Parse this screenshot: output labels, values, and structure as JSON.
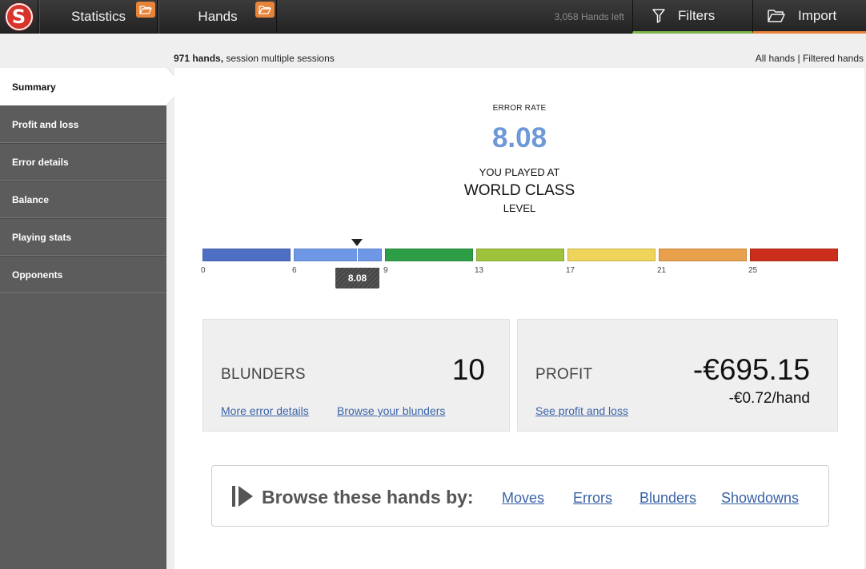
{
  "topbar": {
    "logo_letter": "S",
    "tabs": [
      {
        "label": "Statistics"
      },
      {
        "label": "Hands"
      }
    ],
    "hands_left": "3,058 Hands left",
    "filters_label": "Filters",
    "import_label": "Import",
    "colors": {
      "filters_accent": "#7ab648",
      "import_accent": "#e8833a",
      "logo": "#d8342c"
    }
  },
  "session": {
    "count": "971 hands,",
    "description": "session multiple sessions",
    "filter_text": "All hands | Filtered hands"
  },
  "sidebar": {
    "items": [
      {
        "label": "Summary",
        "active": true
      },
      {
        "label": "Profit and loss"
      },
      {
        "label": "Error details"
      },
      {
        "label": "Balance"
      },
      {
        "label": "Playing stats"
      },
      {
        "label": "Opponents"
      }
    ]
  },
  "summary": {
    "error_rate_label": "ERROR RATE",
    "error_rate": "8.08",
    "played_at": "YOU PLAYED AT",
    "level_name": "WORLD CLASS",
    "level_word": "LEVEL",
    "scale": {
      "ticks": [
        "0",
        "6",
        "9",
        "13",
        "17",
        "21",
        "25"
      ],
      "marker_value": 8.08,
      "marker_label": "8.08",
      "segment_colors": [
        "#4f6fc4",
        "#6e98e6",
        "#2e9e46",
        "#9fc23c",
        "#eed45a",
        "#e8a04a",
        "#cc2e1c"
      ]
    }
  },
  "blunders": {
    "label": "BLUNDERS",
    "value": "10",
    "link_details": "More error details",
    "link_browse": "Browse your blunders"
  },
  "profit": {
    "label": "PROFIT",
    "value": "-€695.15",
    "per_hand": "-€0.72/hand",
    "link": "See profit and loss"
  },
  "browse": {
    "title": "Browse these hands by:",
    "links": [
      "Moves",
      "Errors",
      "Blunders",
      "Showdowns"
    ]
  }
}
